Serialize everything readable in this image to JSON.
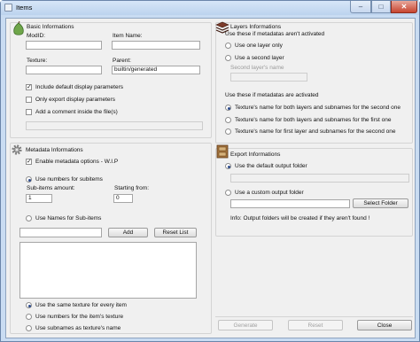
{
  "window": {
    "title": "Items"
  },
  "basic": {
    "title": "Basic Informations",
    "modid_label": "ModID:",
    "modid_value": "",
    "itemname_label": "Item Name:",
    "itemname_value": "",
    "texture_label": "Texture:",
    "texture_value": "",
    "parent_label": "Parent:",
    "parent_value": "builtin/generated",
    "include_display": "Include default display parameters",
    "only_export": "Only export display parameters",
    "add_comment": "Add a comment inside the file(s)",
    "comment_value": ""
  },
  "layers": {
    "title": "Layers Informations",
    "intro": "Use these if metadatas aren't activated",
    "use_one": "Use one layer only",
    "use_second": "Use a second layer",
    "second_name_label": "Second layer's name",
    "second_name_value": "",
    "meta_intro": "Use these if metadatas are activated",
    "opt_both_second": "Texture's name for both layers and subnames for the second one",
    "opt_both_first": "Texture's name for both layers and subnames for the first one",
    "opt_first_both": "Texture's name for first layer and subnames for the second one"
  },
  "metadata": {
    "title": "Metadata Informations",
    "enable": "Enable metadata options - W.I.P",
    "use_numbers": "Use numbers for subitems",
    "subitems_label": "Sub-items amount:",
    "subitems_value": "1",
    "starting_label": "Starting from:",
    "starting_value": "0",
    "use_names": "Use Names for Sub-items",
    "name_input_value": "",
    "add": "Add",
    "reset": "Reset List",
    "same_texture": "Use the same texture for every item",
    "numbers_texture": "Use numbers for the item's texture",
    "subnames_texture": "Use subnames as texture's name"
  },
  "export": {
    "title": "Export Informations",
    "default_folder": "Use the default output folder",
    "default_path_value": "",
    "custom_folder": "Use a custom output folder",
    "custom_path_value": "",
    "select_folder": "Select Folder",
    "info": "Info: Output folders will be created if they aren't found !"
  },
  "footer": {
    "generate": "Generate",
    "reset": "Reset",
    "close": "Close"
  }
}
